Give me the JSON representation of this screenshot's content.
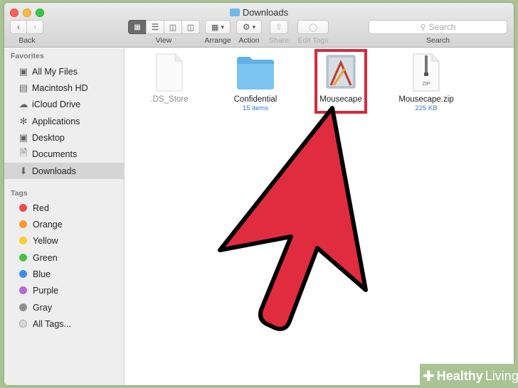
{
  "window": {
    "title": "Downloads"
  },
  "toolbar": {
    "back_label": "Back",
    "view_label": "View",
    "arrange_label": "Arrange",
    "action_label": "Action",
    "share_label": "Share",
    "edit_tags_label": "Edit Tags",
    "search_label": "Search",
    "search_placeholder": "Search"
  },
  "sidebar": {
    "favorites_heading": "Favorites",
    "favorites": [
      {
        "label": "All My Files",
        "icon": "all-files-icon"
      },
      {
        "label": "Macintosh HD",
        "icon": "hard-drive-icon"
      },
      {
        "label": "iCloud Drive",
        "icon": "cloud-icon"
      },
      {
        "label": "Applications",
        "icon": "applications-icon"
      },
      {
        "label": "Desktop",
        "icon": "desktop-icon"
      },
      {
        "label": "Documents",
        "icon": "documents-icon"
      },
      {
        "label": "Downloads",
        "icon": "downloads-icon",
        "selected": true
      }
    ],
    "tags_heading": "Tags",
    "tags": [
      {
        "label": "Red",
        "color": "#f1484a"
      },
      {
        "label": "Orange",
        "color": "#f79a2c"
      },
      {
        "label": "Yellow",
        "color": "#f6d02a"
      },
      {
        "label": "Green",
        "color": "#4bbf3f"
      },
      {
        "label": "Blue",
        "color": "#3b8cf0"
      },
      {
        "label": "Purple",
        "color": "#b46ad6"
      },
      {
        "label": "Gray",
        "color": "#8e8e8e"
      },
      {
        "label": "All Tags...",
        "color": "#d8d8d8"
      }
    ]
  },
  "files": [
    {
      "name": ".DS_Store",
      "sub": "",
      "icon": "blank-document-icon"
    },
    {
      "name": "Confidential",
      "sub": "15 items",
      "icon": "folder-icon"
    },
    {
      "name": "Mousecape",
      "sub": "",
      "icon": "application-icon"
    },
    {
      "name": "Mousecape.zip",
      "sub": "225 KB",
      "icon": "zip-archive-icon",
      "zip_label": "ZIP"
    }
  ],
  "annotation": {
    "color": "#e02c3e",
    "outline": "#000000"
  },
  "watermark": {
    "word1": "Healthy",
    "word2": "Living"
  }
}
